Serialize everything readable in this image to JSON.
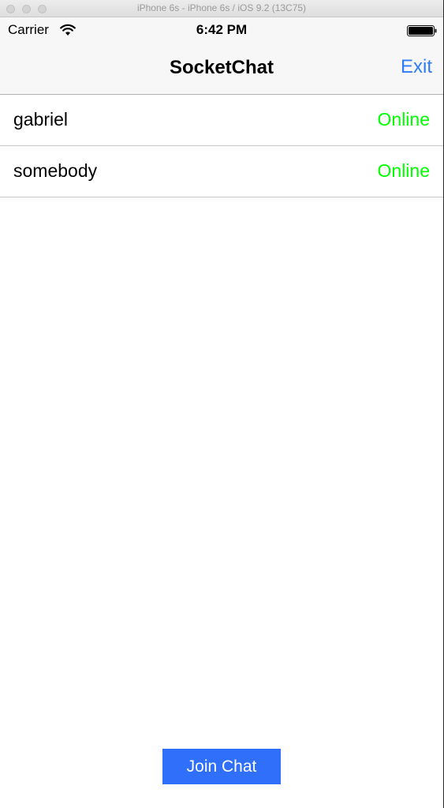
{
  "simulator": {
    "title": "iPhone 6s - iPhone 6s / iOS 9.2 (13C75)"
  },
  "status_bar": {
    "carrier": "Carrier",
    "time": "6:42 PM",
    "wifi_icon": "wifi-icon",
    "battery_icon": "battery-full-icon"
  },
  "nav": {
    "title": "SocketChat",
    "exit_label": "Exit"
  },
  "users": [
    {
      "name": "gabriel",
      "status": "Online"
    },
    {
      "name": "somebody",
      "status": "Online"
    }
  ],
  "actions": {
    "join_label": "Join Chat"
  },
  "colors": {
    "accent": "#2f7cf6",
    "online": "#00ff00",
    "button_bg": "#2f6ffa"
  }
}
